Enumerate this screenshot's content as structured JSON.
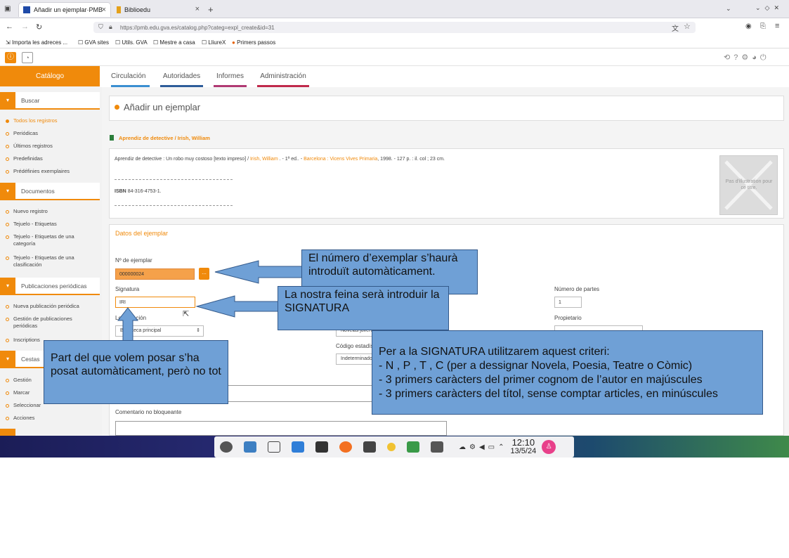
{
  "browser": {
    "tabs": [
      {
        "title": "Añadir un ejemplar·PMB"
      },
      {
        "title": "Biblioedu"
      }
    ],
    "new_tab": "+",
    "url": "https://pmb.edu.gva.es/catalog.php?categ=expl_create&id=31",
    "bookmarks": [
      "Importa les adreces ...",
      "GVA sites",
      "Utils. GVA",
      "Mestre a casa",
      "LliureX",
      "Primers passos"
    ]
  },
  "sidebar": {
    "title": "Catálogo",
    "sections": [
      {
        "label": "Buscar",
        "items": [
          "Todos los registros",
          "Periódicas",
          "Últimos registros",
          "Predefinidas",
          "Prédéfinies exemplaires"
        ]
      },
      {
        "label": "Documentos",
        "items": [
          "Nuevo registro",
          "Tejuelo - Etiquetas",
          "Tejuelo - Etiquetas de una categoría",
          "Tejuelo - Etiquetas de una clasificación"
        ]
      },
      {
        "label": "Publicaciones periódicas",
        "items": [
          "Nueva publicación periódica",
          "Gestión de publicaciones periódicas",
          "Inscriptions"
        ]
      },
      {
        "label": "Cestas",
        "items": [
          "Gestión",
          "Marcar",
          "Seleccionar",
          "Acciones"
        ]
      }
    ]
  },
  "topnav": [
    "Circulación",
    "Autoridades",
    "Informes",
    "Administración"
  ],
  "topnav_colors": [
    "#3b8fd1",
    "#2e5d9a",
    "#b03a73",
    "#c0294b"
  ],
  "page": {
    "title": "Añadir un ejemplar",
    "record_link": "Aprendiz de detective / Irish, William",
    "record_desc_1": "Aprendiz de detective : Un robo muy costoso [texto impreso] / ",
    "record_author": "Irish, William",
    "record_desc_2": " . - 1ª ed.. - ",
    "record_publisher": "Barcelona : Vicens Vives Primaria",
    "record_desc_3": ", 1998. - 127 p. : il. col ; 23 cm.",
    "isbn_label": "ISBN",
    "isbn_value": "84-316-4753-1.",
    "cover_text": "Pas d'illustration pour ce titre."
  },
  "form": {
    "section_title": "Datos del ejemplar",
    "num_label": "Nº de ejemplar",
    "num_value": "000000024",
    "num_button": "...",
    "sig_label": "Signatura",
    "sig_value": "IRI",
    "loc_label": "Localización",
    "loc_value": "Biblioteca principal",
    "sect_value": "Novelas juveniles",
    "state_label": "Código estadístico",
    "state_value": "Indeterminado",
    "parts_label": "Número de partes",
    "parts_value": "1",
    "owner_label": "Propietario",
    "comment_label": "Comentario no bloqueante"
  },
  "callouts": {
    "c1": "El número d’exemplar s’haurà introduït automàticament.",
    "c2": "La nostra feina serà introduir la SIGNATURA",
    "c3": "Part del que volem posar s’ha posat automàticament, però no tot",
    "c4_lines": [
      "Per a la SIGNATURA utilitzarem aquest criteri:",
      "- N , P , T , C (per a dessignar Novela, Poesia, Teatre o Còmic)",
      "- 3 primers caràcters del primer cognom de l’autor en majúscules",
      "- 3 primers caràcters del títol, sense comptar articles, en minúscules"
    ]
  },
  "taskbar": {
    "time": "12:10",
    "date": "13/5/24"
  }
}
